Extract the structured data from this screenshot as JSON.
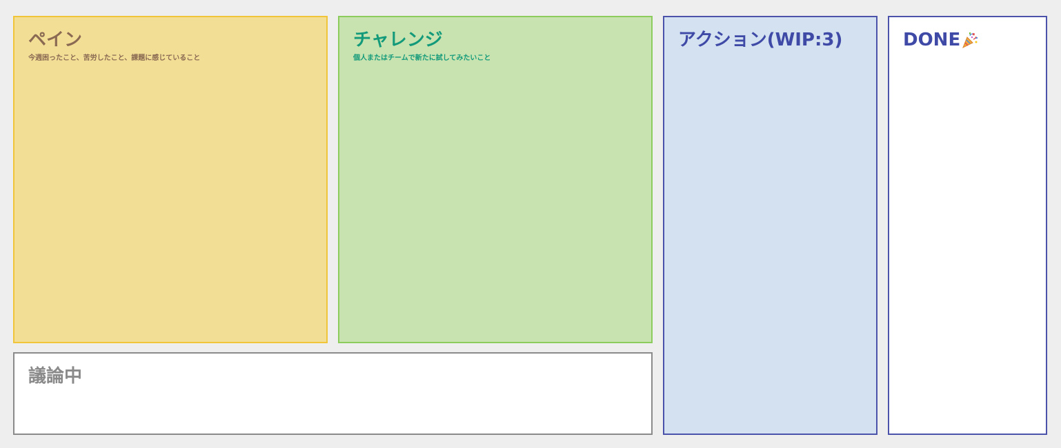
{
  "panels": {
    "pain": {
      "title": "ペイン",
      "subtitle": "今週困ったこと、苦労したこと、課題に感じていること"
    },
    "challenge": {
      "title": "チャレンジ",
      "subtitle": "個人またはチームで新たに試してみたいこと"
    },
    "action": {
      "title": "アクション(WIP:3)"
    },
    "done": {
      "title": "DONE",
      "icon": "party-popper-icon"
    },
    "discussion": {
      "title": "議論中"
    }
  },
  "colors": {
    "background": "#eeeeee",
    "pain_fill": "#f3de96",
    "pain_border": "#f0c53a",
    "pain_text": "#8a6a52",
    "challenge_fill": "#c9e3b0",
    "challenge_border": "#8ccc5c",
    "challenge_text": "#139a7a",
    "action_fill": "#d3e1f1",
    "action_border": "#4a53a9",
    "action_text": "#3f4aa7",
    "done_fill": "#ffffff",
    "discussion_border": "#8a8a8a",
    "discussion_text": "#8a8a8a"
  }
}
